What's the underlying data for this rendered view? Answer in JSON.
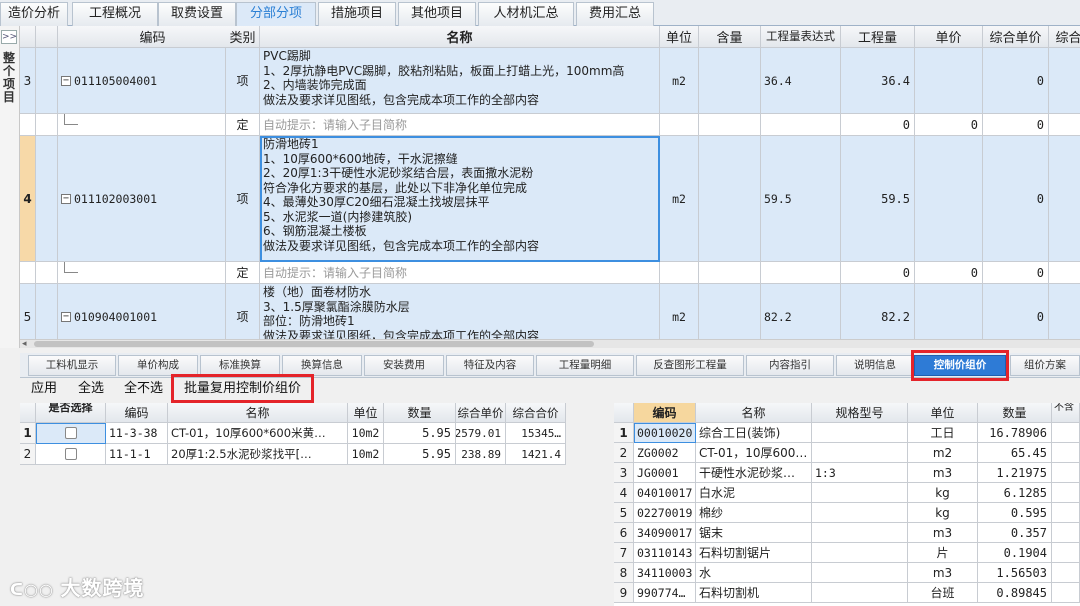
{
  "top_tabs": [
    "造价分析",
    "工程概况",
    "取费设置",
    "分部分项",
    "措施项目",
    "其他项目",
    "人材机汇总",
    "费用汇总"
  ],
  "left_panel": {
    "expander": ">>",
    "label": "整个项目"
  },
  "grid": {
    "headers": [
      "编码",
      "类别",
      "名称",
      "单位",
      "含量",
      "工程量表达式",
      "工程量",
      "单价",
      "综合单价",
      "综合"
    ],
    "rows": [
      {
        "no": "3",
        "code": "011105004001",
        "type": "项",
        "name": "PVC踢脚\n1、2厚抗静电PVC踢脚，胶粘剂粘贴，板面上打蜡上光，100mm高\n2、内墙装饰完成面\n做法及要求详见图纸，包含完成本项工作的全部内容",
        "unit": "m2",
        "expr": "36.4",
        "qty": "36.4",
        "price": "",
        "unit_price": "0"
      },
      {
        "no": "",
        "code": "",
        "type": "定",
        "name": "自动提示：请输入子目简称",
        "unit": "",
        "expr": "",
        "qty": "0",
        "price": "0",
        "unit_price": "0"
      },
      {
        "no": "4",
        "code": "011102003001",
        "type": "项",
        "name": "防滑地砖1\n1、10厚600*600地砖，干水泥擦缝\n2、20厚1:3干硬性水泥砂浆结合层，表面撒水泥粉\n符合净化方要求的基层，此处以下非净化单位完成\n4、最薄处30厚C20细石混凝土找坡层抹平\n5、水泥浆一道(内掺建筑胶)\n6、钢筋混凝土楼板\n做法及要求详见图纸，包含完成本项工作的全部内容",
        "unit": "m2",
        "expr": "59.5",
        "qty": "59.5",
        "price": "",
        "unit_price": "0"
      },
      {
        "no": "",
        "code": "",
        "type": "定",
        "name": "自动提示：请输入子目简称",
        "unit": "",
        "expr": "",
        "qty": "0",
        "price": "0",
        "unit_price": "0"
      },
      {
        "no": "5",
        "code": "010904001001",
        "type": "项",
        "name": "楼（地）面卷材防水\n3、1.5厚聚氯酯涂膜防水层\n部位：防滑地砖1\n做法及要求详见图纸，包含完成本项工作的全部内容",
        "unit": "m2",
        "expr": "82.2",
        "qty": "82.2",
        "price": "",
        "unit_price": "0"
      }
    ]
  },
  "bottom_tabs": [
    "工料机显示",
    "单价构成",
    "标准换算",
    "换算信息",
    "安装费用",
    "特征及内容",
    "工程量明细",
    "反查图形工程量",
    "内容指引",
    "说明信息",
    "控制价组价",
    "组价方案"
  ],
  "toolbar": {
    "apply": "应用",
    "select_all": "全选",
    "select_none": "全不选",
    "batch_reuse": "批量复用控制价组价"
  },
  "left_table": {
    "headers": [
      "是否选择",
      "编码",
      "名称",
      "单位",
      "数量",
      "综合单价",
      "综合合价"
    ],
    "rows": [
      {
        "no": "1",
        "code": "11-3-38",
        "name": "CT-01，10厚600*600米黄…",
        "unit": "10m2",
        "qty": "5.95",
        "unit_price": "2579.01",
        "total": "15345…"
      },
      {
        "no": "2",
        "code": "11-1-1",
        "name": "20厚1:2.5水泥砂浆找平[…",
        "unit": "10m2",
        "qty": "5.95",
        "unit_price": "238.89",
        "total": "1421.4"
      }
    ]
  },
  "right_table": {
    "headers": [
      "编码",
      "名称",
      "规格型号",
      "单位",
      "数量",
      "不含"
    ],
    "rows": [
      {
        "no": "1",
        "code": "00010020",
        "name": "综合工日(装饰)",
        "spec": "",
        "unit": "工日",
        "qty": "16.78906"
      },
      {
        "no": "2",
        "code": "ZG0002",
        "name": "CT-01，10厚600…",
        "spec": "",
        "unit": "m2",
        "qty": "65.45"
      },
      {
        "no": "3",
        "code": "JG0001",
        "name": "干硬性水泥砂浆…",
        "spec": "1:3",
        "unit": "m3",
        "qty": "1.21975"
      },
      {
        "no": "4",
        "code": "04010017",
        "name": "白水泥",
        "spec": "",
        "unit": "kg",
        "qty": "6.1285"
      },
      {
        "no": "5",
        "code": "02270019",
        "name": "棉纱",
        "spec": "",
        "unit": "kg",
        "qty": "0.595"
      },
      {
        "no": "6",
        "code": "34090017",
        "name": "锯末",
        "spec": "",
        "unit": "m3",
        "qty": "0.357"
      },
      {
        "no": "7",
        "code": "03110143",
        "name": "石料切割锯片",
        "spec": "",
        "unit": "片",
        "qty": "0.1904"
      },
      {
        "no": "8",
        "code": "34110003",
        "name": "水",
        "spec": "",
        "unit": "m3",
        "qty": "1.56503"
      },
      {
        "no": "9",
        "code": "990774…",
        "name": "石料切割机",
        "spec": "",
        "unit": "台班",
        "qty": "0.89845"
      }
    ]
  },
  "watermark": "大数跨境",
  "colors": {
    "selected_row": "#dbe9f8",
    "active_tab": "#2e7bd6",
    "highlight": "#e4242a"
  }
}
